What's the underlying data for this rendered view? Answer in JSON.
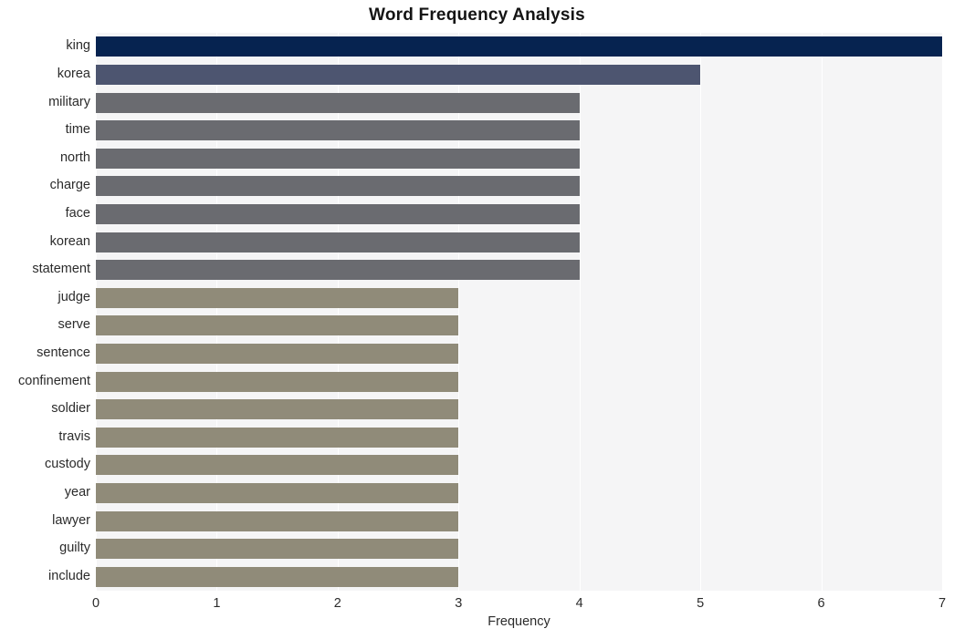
{
  "chart_data": {
    "type": "bar",
    "orientation": "horizontal",
    "title": "Word Frequency Analysis",
    "xlabel": "Frequency",
    "ylabel": "",
    "xlim": [
      0,
      7
    ],
    "xticks": [
      "0",
      "1",
      "2",
      "3",
      "4",
      "5",
      "6",
      "7"
    ],
    "grid": true,
    "legend": false,
    "categories": [
      "king",
      "korea",
      "military",
      "time",
      "north",
      "charge",
      "face",
      "korean",
      "statement",
      "judge",
      "serve",
      "sentence",
      "confinement",
      "soldier",
      "travis",
      "custody",
      "year",
      "lawyer",
      "guilty",
      "include"
    ],
    "values": [
      7,
      5,
      4,
      4,
      4,
      4,
      4,
      4,
      4,
      3,
      3,
      3,
      3,
      3,
      3,
      3,
      3,
      3,
      3,
      3
    ],
    "bar_colors": [
      "#062350",
      "#4d5570",
      "#6a6b70",
      "#6a6b70",
      "#6a6b70",
      "#6a6b70",
      "#6a6b70",
      "#6a6b70",
      "#6a6b70",
      "#908b79",
      "#908b79",
      "#908b79",
      "#908b79",
      "#908b79",
      "#908b79",
      "#908b79",
      "#908b79",
      "#908b79",
      "#908b79",
      "#908b79"
    ]
  },
  "style": {
    "plot_background": "#f5f5f6",
    "grid_color": "#ffffff",
    "figure_background": "#ffffff",
    "text_color": "#2b2b2b",
    "title_color": "#141414"
  }
}
